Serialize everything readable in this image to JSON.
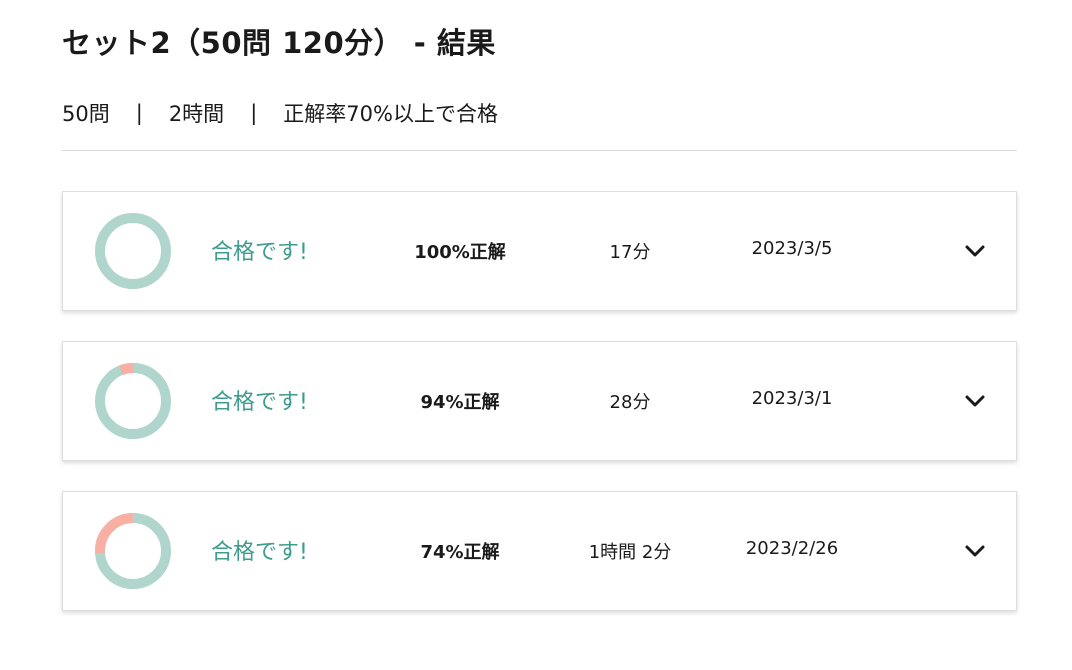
{
  "page": {
    "title": "セット2（50問 120分） - 結果",
    "meta": {
      "questions": "50問",
      "separator": "|",
      "duration": "2時間",
      "pass_rule": "正解率70%以上で合格"
    }
  },
  "colors": {
    "correct": "#b0d5cd",
    "incorrect": "#f7b0a3",
    "pass_text": "#3d9c8c"
  },
  "results": [
    {
      "status": "合格です!",
      "score_label": "100%正解",
      "correct_ratio": 1.0,
      "time": "17分",
      "date": "2023/3/5",
      "expand_icon": "chevron-down-icon"
    },
    {
      "status": "合格です!",
      "score_label": "94%正解",
      "correct_ratio": 0.94,
      "time": "28分",
      "date": "2023/3/1",
      "expand_icon": "chevron-down-icon"
    },
    {
      "status": "合格です!",
      "score_label": "74%正解",
      "correct_ratio": 0.74,
      "time": "1時間 2分",
      "date": "2023/2/26",
      "expand_icon": "chevron-down-icon"
    }
  ]
}
